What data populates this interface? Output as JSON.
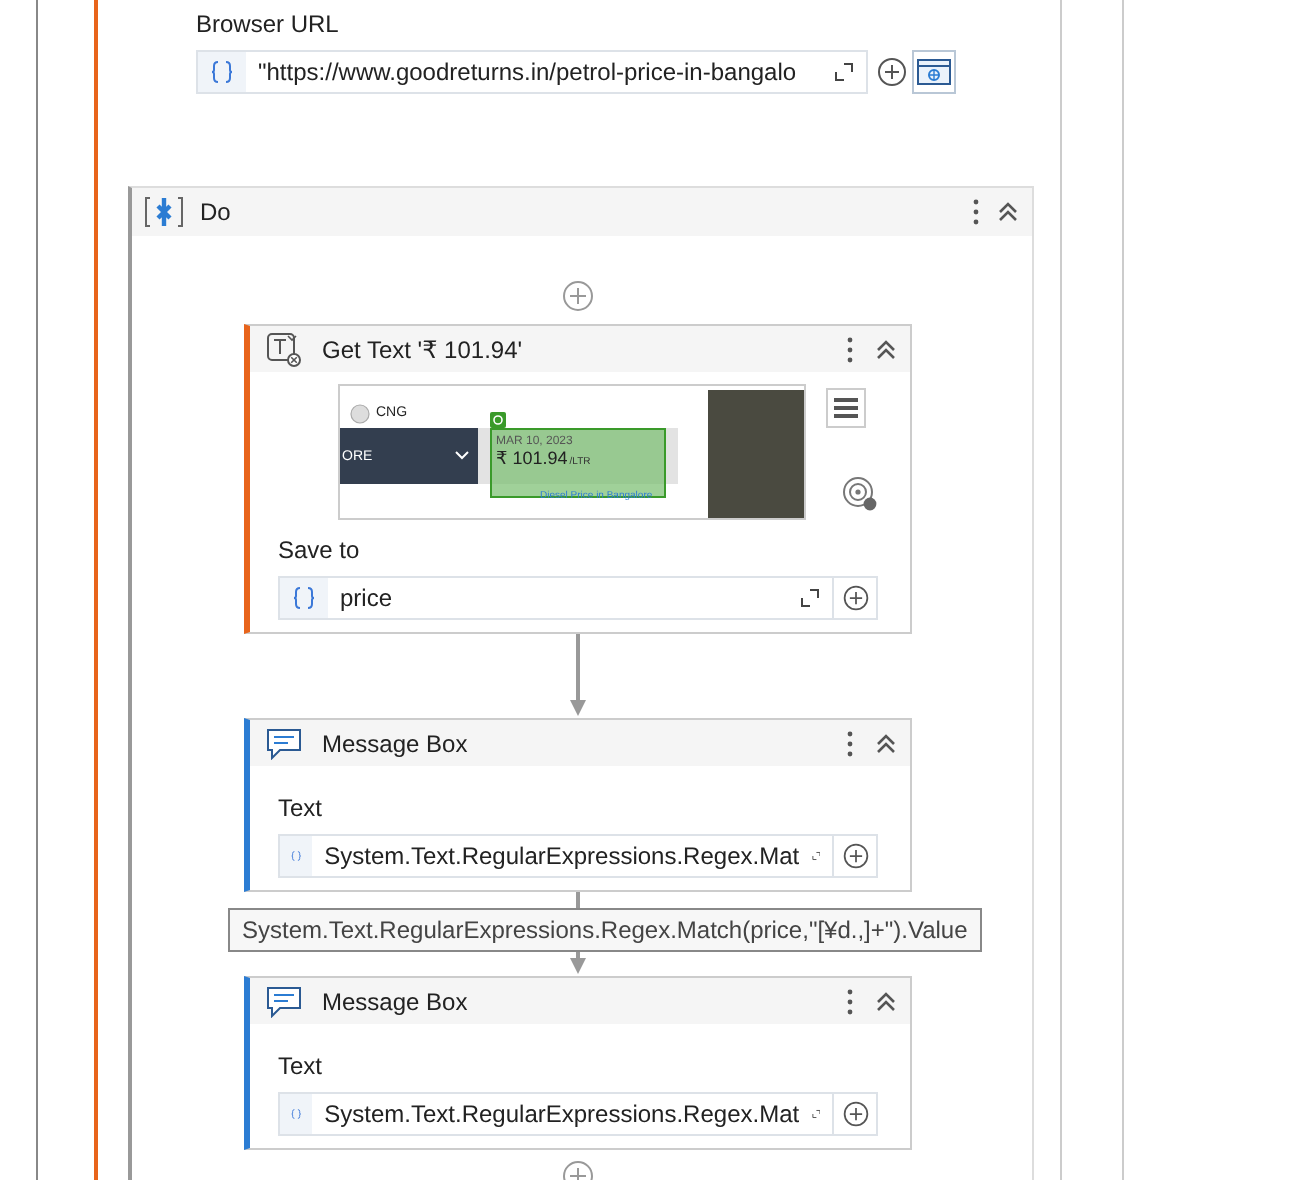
{
  "browser_url": {
    "label": "Browser URL",
    "value": "\"https://www.goodreturns.in/petrol-price-in-bangalo"
  },
  "do": {
    "title": "Do"
  },
  "activities": [
    {
      "kind": "get_text",
      "title": "Get Text '₹ 101.94'",
      "field_label": "Save to",
      "field_value": "price",
      "preview": {
        "radio_label": "CNG",
        "dropdown_text": "ORE",
        "date": "MAR 10, 2023",
        "price": "₹ 101.94",
        "unit": "/LTR",
        "link": "Diesel Price in Bangalore"
      }
    },
    {
      "kind": "message_box",
      "title": "Message Box",
      "field_label": "Text",
      "field_value": "System.Text.RegularExpressions.Regex.Mat"
    },
    {
      "kind": "message_box",
      "title": "Message Box",
      "field_label": "Text",
      "field_value": "System.Text.RegularExpressions.Regex.Mat"
    }
  ],
  "tooltip": "System.Text.RegularExpressions.Regex.Match(price,\"[¥d.,]+\").Value"
}
